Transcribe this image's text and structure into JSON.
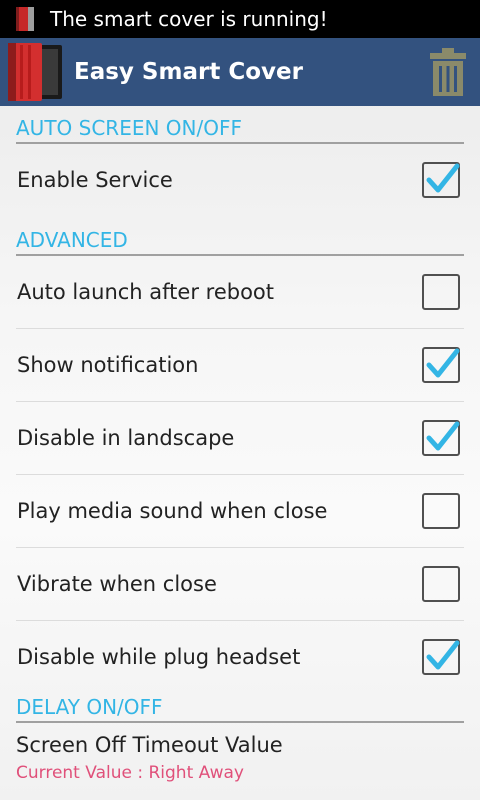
{
  "status_bar": {
    "notification_text": "The smart cover is running!",
    "notification_icon": "book-cover-icon"
  },
  "action_bar": {
    "title": "Easy Smart Cover",
    "app_icon": "smart-cover-app-icon",
    "action_icon": "trash-icon"
  },
  "sections": {
    "auto_screen": {
      "title": "AUTO SCREEN ON/OFF",
      "items": [
        {
          "label": "Enable Service",
          "checked": true
        }
      ]
    },
    "advanced": {
      "title": "ADVANCED",
      "items": [
        {
          "label": "Auto launch after reboot",
          "checked": false
        },
        {
          "label": "Show notification",
          "checked": true
        },
        {
          "label": "Disable in landscape",
          "checked": true
        },
        {
          "label": "Play media sound when close",
          "checked": false
        },
        {
          "label": "Vibrate when close",
          "checked": false
        },
        {
          "label": "Disable while plug headset",
          "checked": true
        }
      ]
    },
    "delay": {
      "title": "DELAY ON/OFF",
      "preference": {
        "title": "Screen Off Timeout Value",
        "summary": "Current Value : Right Away"
      }
    }
  },
  "colors": {
    "accent": "#33b5e5",
    "action_bar": "#33527f",
    "summary_text": "#e0507a"
  }
}
